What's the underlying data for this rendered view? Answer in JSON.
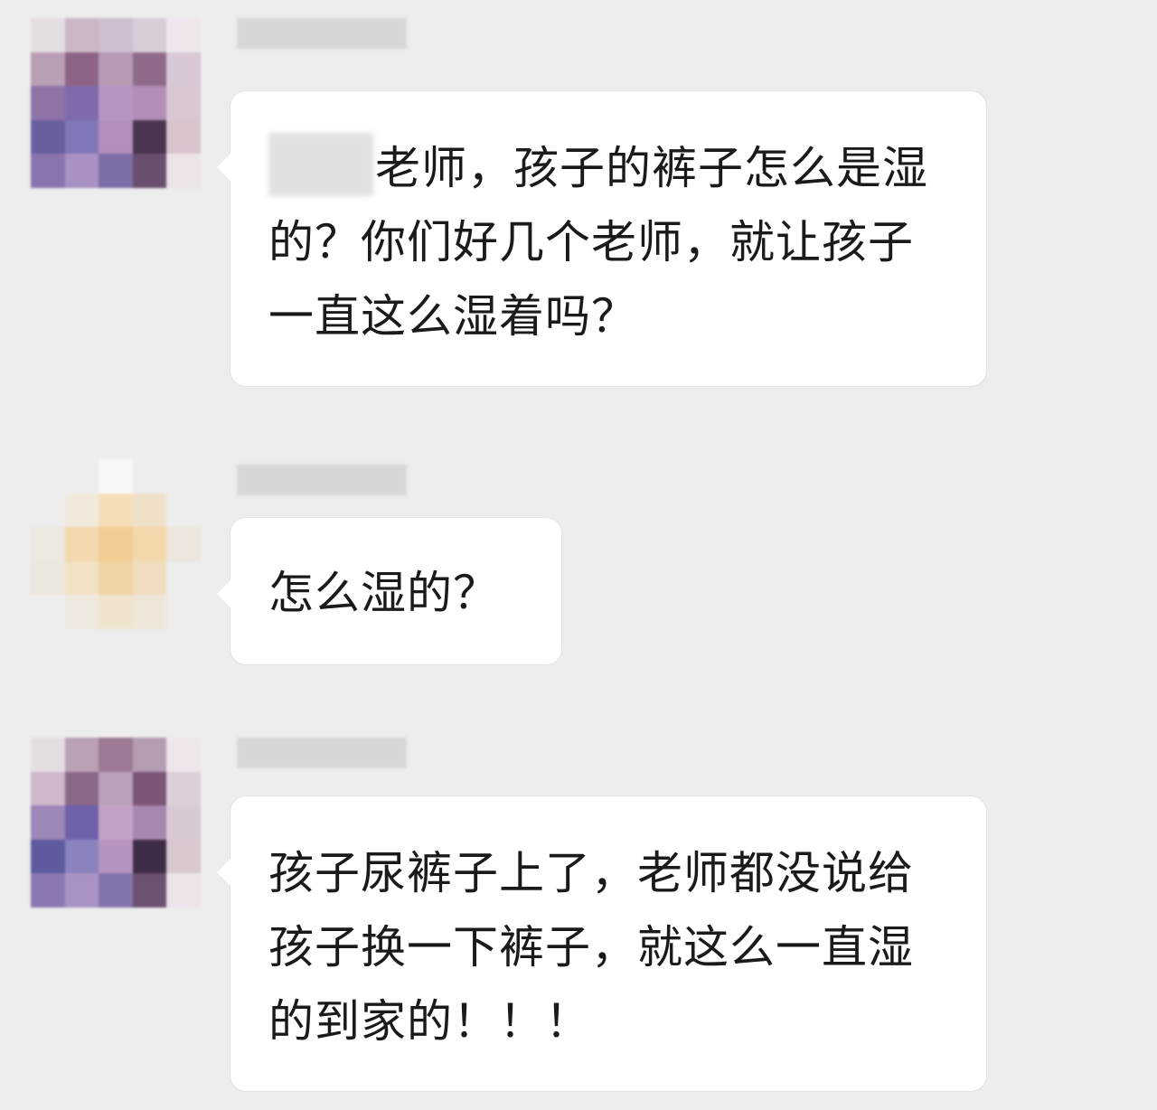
{
  "messages": [
    {
      "sender_redacted": true,
      "avatar_palette": [
        [
          "#e4dde3",
          "#cbb8c7",
          "#cdbed0",
          "#d7cdd7",
          "#eee6ec"
        ],
        [
          "#b99fb4",
          "#8d6386",
          "#b69ab4",
          "#8f6b89",
          "#d9c8d6"
        ],
        [
          "#8e73a7",
          "#7f6aac",
          "#b596c2",
          "#b28fb6",
          "#d8c6d2"
        ],
        [
          "#66609e",
          "#7f78b8",
          "#b28fbd",
          "#4a3550",
          "#d7c4cf"
        ],
        [
          "#8b74ad",
          "#a991c3",
          "#7d6ea8",
          "#6a4e6e",
          "#ece4ea"
        ]
      ],
      "text": "老师，孩子的裤子怎么是湿的？你们好几个老师，就让孩子一直这么湿着吗？"
    },
    {
      "sender_redacted": true,
      "avatar_palette": [
        [
          "#ededed",
          "#ededed",
          "#f8f8f8",
          "#ededed",
          "#ededed"
        ],
        [
          "#ededed",
          "#f1e9dc",
          "#f6dfb8",
          "#efe0c8",
          "#ededed"
        ],
        [
          "#ede8e0",
          "#f2d9ae",
          "#f1cd93",
          "#f3d8ac",
          "#ece6dc"
        ],
        [
          "#ece7de",
          "#f3e1c4",
          "#f1d4a5",
          "#f0dcbe",
          "#ededed"
        ],
        [
          "#ededed",
          "#eee8de",
          "#f0e4cf",
          "#eee6d8",
          "#ededed"
        ]
      ],
      "text": "怎么湿的？"
    },
    {
      "sender_redacted": true,
      "avatar_palette": [
        [
          "#e4dde3",
          "#b9a0b5",
          "#9c7a95",
          "#b49cb3",
          "#eee6ec"
        ],
        [
          "#cdb9cb",
          "#8a6888",
          "#b8a0b8",
          "#7a5576",
          "#dccfd9"
        ],
        [
          "#9c87b8",
          "#6f62aa",
          "#c2a3c6",
          "#a687ad",
          "#d9c9d5"
        ],
        [
          "#5e5a9d",
          "#8a83be",
          "#b694c0",
          "#3e2c46",
          "#d8c6d0"
        ],
        [
          "#8c78b0",
          "#a993c4",
          "#8374ad",
          "#6c5170",
          "#ece4ea"
        ]
      ],
      "text": "孩子尿裤子上了，老师都没说给孩子换一下裤子，就这么一直湿的到家的！！！"
    }
  ]
}
